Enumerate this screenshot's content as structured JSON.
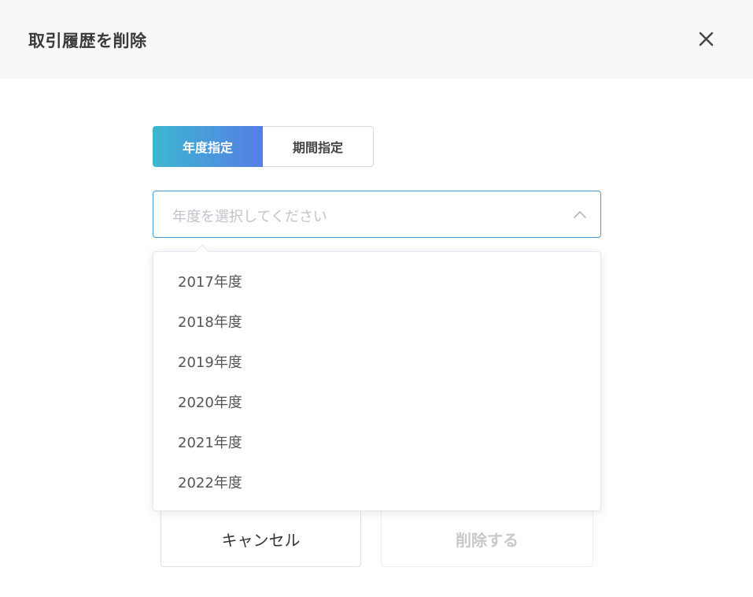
{
  "dialog": {
    "title": "取引履歴を削除",
    "close_icon": "close-icon"
  },
  "tabs": [
    {
      "label": "年度指定",
      "active": true
    },
    {
      "label": "期間指定",
      "active": false
    }
  ],
  "select": {
    "placeholder": "年度を選択してください",
    "expanded": true,
    "icon": "chevron-up-icon"
  },
  "options": [
    {
      "label": "2017年度"
    },
    {
      "label": "2018年度"
    },
    {
      "label": "2019年度"
    },
    {
      "label": "2020年度"
    },
    {
      "label": "2021年度"
    },
    {
      "label": "2022年度"
    }
  ],
  "buttons": {
    "cancel_label": "キャンセル",
    "delete_label": "削除する",
    "delete_disabled": true
  },
  "colors": {
    "accent_gradient_start": "#3cb7d0",
    "accent_gradient_end": "#567de6",
    "focus_border": "#4a9ed9"
  }
}
